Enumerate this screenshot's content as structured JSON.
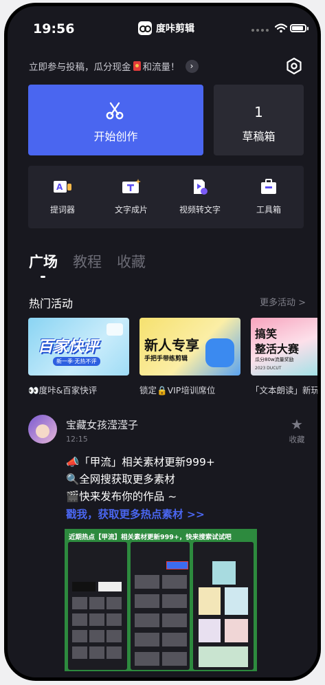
{
  "status_bar": {
    "time": "19:56"
  },
  "app": {
    "title": "度咔剪辑"
  },
  "promo": {
    "text_before": "立即参与投稿，瓜分现金",
    "text_after": "和流量！"
  },
  "main_cards": {
    "create_label": "开始创作",
    "drafts_count": "1",
    "drafts_label": "草稿箱"
  },
  "tools": [
    {
      "label": "提词器",
      "icon": "teleprompter-icon"
    },
    {
      "label": "文字成片",
      "icon": "text-to-video-icon"
    },
    {
      "label": "视频转文字",
      "icon": "video-to-text-icon"
    },
    {
      "label": "工具箱",
      "icon": "toolbox-icon"
    }
  ],
  "tabs": [
    {
      "label": "广场",
      "active": true
    },
    {
      "label": "教程",
      "active": false
    },
    {
      "label": "收藏",
      "active": false
    }
  ],
  "hot": {
    "title": "热门活动",
    "more": "更多活动 >",
    "activities": [
      {
        "caption": "👀度咔&百家快评",
        "banner_text": "百家快评",
        "banner_sub": "新一季·无热不评"
      },
      {
        "caption": "锁定🔒VIP培训席位",
        "banner_text": "新人专享",
        "banner_sub": "手把手带练剪辑"
      },
      {
        "caption": "「文本朗读」新玩",
        "banner_text_1": "搞笑",
        "banner_text_2": "整活大赛",
        "banner_sub": "瓜分80w流量奖励",
        "banner_small": "2023 DUCUT"
      }
    ]
  },
  "post": {
    "user": "宝藏女孩滢滢子",
    "time": "12:15",
    "favorite_label": "收藏",
    "lines": [
      "📣「甲流」相关素材更新999+",
      "🔍全网搜获取更多素材",
      "🎬快来发布你的作品 ~"
    ],
    "link": "戳我，获取更多热点素材 >>",
    "image_caption": "近期热点【甲流】相关素材更新999+，快来搜索试试吧"
  },
  "colors": {
    "accent": "#4a66f0",
    "background": "#18181f",
    "card": "#2a2a33"
  }
}
